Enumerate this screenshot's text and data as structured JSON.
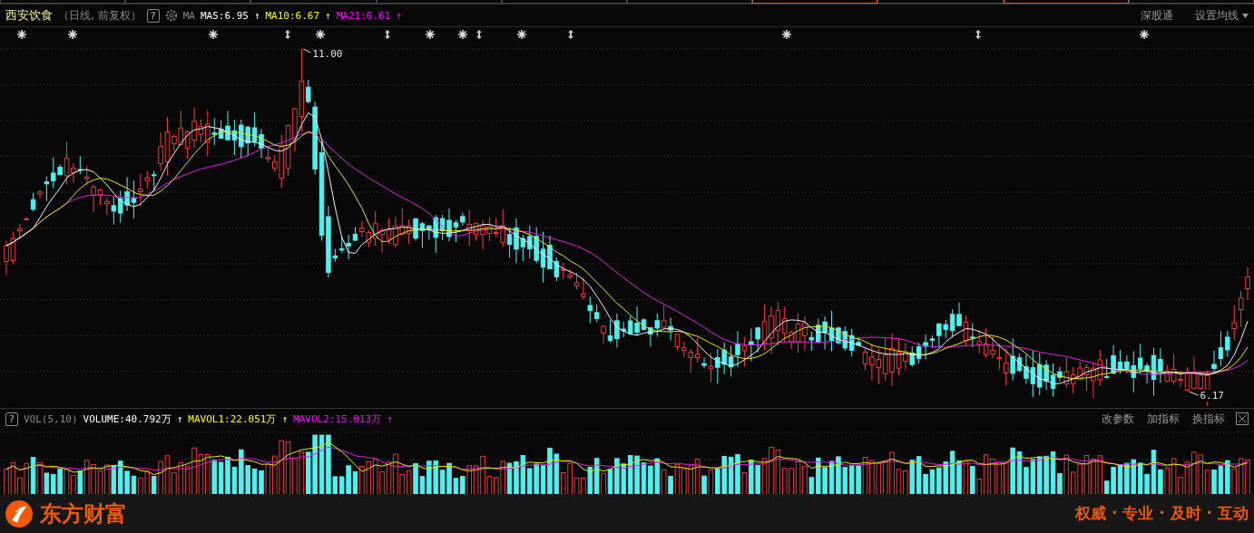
{
  "header": {
    "title": "西安饮食",
    "subtitle": "（日线, 前复权）",
    "help": "?",
    "indicator": "MA",
    "values": [
      {
        "label": "MA5:6.95",
        "arrow": "↑",
        "color": "#ffffff"
      },
      {
        "label": "MA10:6.67",
        "arrow": "↑",
        "color": "#ffff00"
      },
      {
        "label": "MA21:6.61",
        "arrow": "↑",
        "color": "#ff00ff"
      }
    ],
    "links": [
      "深股通",
      "设置均线"
    ]
  },
  "price_chart": {
    "high_label": "11.00",
    "low_label": "6.17"
  },
  "volume_header": {
    "help": "?",
    "indicator": "VOL(5,10)",
    "values": [
      {
        "label": "VOLUME:40.792万",
        "arrow": "↑",
        "color": "#ffffff"
      },
      {
        "label": "MAVOL1:22.051万",
        "arrow": "↑",
        "color": "#ffff00"
      },
      {
        "label": "MAVOL2:15.013万",
        "arrow": "↑",
        "color": "#ff00ff"
      }
    ],
    "links": [
      "改参数",
      "加指标",
      "换指标"
    ]
  },
  "footer": {
    "brand": "东方财富",
    "slogan": "权威 · 专业 · 及时 · 互动"
  }
}
